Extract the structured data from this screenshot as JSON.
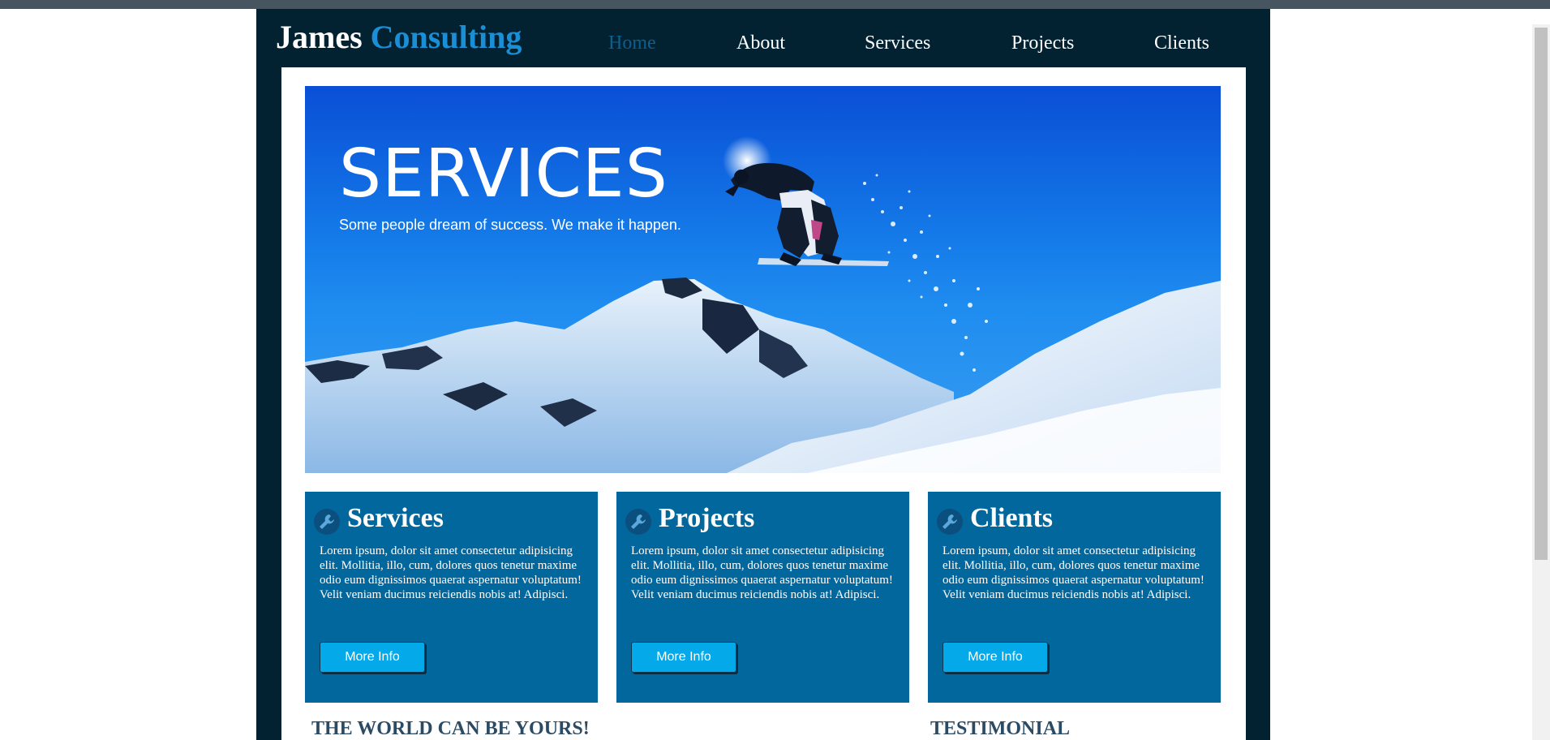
{
  "logo": {
    "name": "James",
    "accent": "Consulting"
  },
  "nav": {
    "items": [
      {
        "label": "Home",
        "active": true
      },
      {
        "label": "About",
        "active": false
      },
      {
        "label": "Services",
        "active": false
      },
      {
        "label": "Projects",
        "active": false
      },
      {
        "label": "Clients",
        "active": false
      }
    ]
  },
  "hero": {
    "title": "SERVICES",
    "subtitle": "Some people dream of success. We make it happen."
  },
  "cards": [
    {
      "title": "Services",
      "icon": "wrench-icon",
      "text": "Lorem ipsum, dolor sit amet consectetur adipisicing elit. Mollitia, illo, cum, dolores quos tenetur maxime odio eum dignissimos quaerat aspernatur voluptatum! Velit veniam ducimus reiciendis nobis at! Adipisci.",
      "button": "More Info"
    },
    {
      "title": "Projects",
      "icon": "wrench-icon",
      "text": "Lorem ipsum, dolor sit amet consectetur adipisicing elit. Mollitia, illo, cum, dolores quos tenetur maxime odio eum dignissimos quaerat aspernatur voluptatum! Velit veniam ducimus reiciendis nobis at! Adipisci.",
      "button": "More Info"
    },
    {
      "title": "Clients",
      "icon": "wrench-icon",
      "text": "Lorem ipsum, dolor sit amet consectetur adipisicing elit. Mollitia, illo, cum, dolores quos tenetur maxime odio eum dignissimos quaerat aspernatur voluptatum! Velit veniam ducimus reiciendis nobis at! Adipisci.",
      "button": "More Info"
    }
  ],
  "sections": {
    "world": "THE WORLD CAN BE YOURS!",
    "testimonial": "TESTIMONIAL"
  },
  "colors": {
    "page_bg": "#022232",
    "accent": "#1a8fd6",
    "card_bg": "#02679d",
    "button_bg": "#03a9e8",
    "nav_active": "#0c5f8e",
    "heading": "#2b4a64"
  }
}
